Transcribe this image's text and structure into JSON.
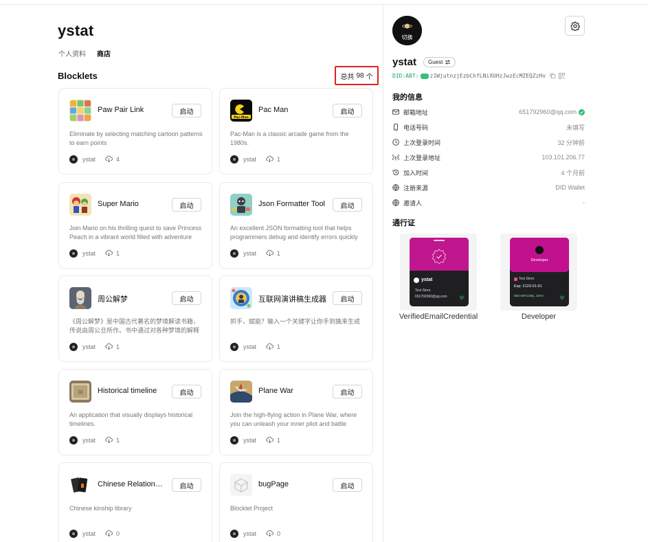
{
  "user": {
    "name": "ystat"
  },
  "nav": {
    "tabs": [
      "个人资料",
      "商店"
    ]
  },
  "blocklets": {
    "title": "Blocklets",
    "total_label": "总共",
    "total_count": "98",
    "total_unit": "个",
    "launch_label": "启动",
    "items": [
      {
        "name": "Paw Pair Link",
        "desc": "Eliminate by selecting matching cartoon patterns to earn points",
        "owner": "ystat",
        "installs": "4",
        "icon": "paw-pair-link-icon"
      },
      {
        "name": "Pac Man",
        "desc": "Pac-Man is a classic arcade game from the 1980s.",
        "owner": "ystat",
        "installs": "1",
        "icon": "pac-man-icon"
      },
      {
        "name": "Super Mario",
        "desc": "Join Mario on his thrilling quest to save Princess Peach in a vibrant world filled with adventure",
        "owner": "ystat",
        "installs": "1",
        "icon": "super-mario-icon"
      },
      {
        "name": "Json Formatter Tool",
        "desc": "An excellent JSON formatting tool that helps programmers debug and identify errors quickly",
        "owner": "ystat",
        "installs": "1",
        "icon": "json-formatter-icon"
      },
      {
        "name": "周公解梦",
        "desc": "《周公解梦》是中国古代著名的梦境解读书籍，传说由周公旦所作。书中通过对各种梦境的解释",
        "owner": "ystat",
        "installs": "1",
        "icon": "zhougong-icon"
      },
      {
        "name": "互联网演讲稿生成器",
        "desc": "抓手，赋能？输入一个关键字让你手到擒来生成",
        "owner": "ystat",
        "installs": "1",
        "icon": "speech-generator-icon"
      },
      {
        "name": "Historical timeline",
        "desc": "An application that visually displays historical timelines.",
        "owner": "ystat",
        "installs": "1",
        "icon": "historical-timeline-icon"
      },
      {
        "name": "Plane War",
        "desc": "Join the high-flying action in Plane War, where you can unleash your inner pilot and battle",
        "owner": "ystat",
        "installs": "1",
        "icon": "plane-war-icon"
      },
      {
        "name": "Chinese Relationship",
        "desc": "Chinese kinship library",
        "owner": "ystat",
        "installs": "0",
        "icon": "chinese-relationship-icon"
      },
      {
        "name": "bugPage",
        "desc": "Blocklet Project",
        "owner": "ystat",
        "installs": "0",
        "icon": "bugpage-icon"
      }
    ]
  },
  "profile": {
    "avatar_switch": "切换",
    "name": "ystat",
    "badge": "Guest",
    "did_prefix": "DID:ABT:",
    "did_value": "z1WjutnzjEzbChfLNiXUHzJwzEcMZEQZzHv",
    "info_title": "我的信息",
    "info": [
      {
        "label": "邮箱地址",
        "value": "651792960@qq.com",
        "icon": "mail-icon"
      },
      {
        "label": "电话号码",
        "value": "未填写",
        "icon": "phone-icon"
      },
      {
        "label": "上次登录时间",
        "value": "32 分钟前",
        "icon": "clock-icon"
      },
      {
        "label": "上次登录地址",
        "value": "103.101.206.77",
        "icon": "signal-icon"
      },
      {
        "label": "加入时间",
        "value": "4 个月前",
        "icon": "history-icon"
      },
      {
        "label": "注册来源",
        "value": "DID Wallet",
        "icon": "globe-icon"
      },
      {
        "label": "邀请人",
        "value": "-",
        "icon": "globe-user-icon"
      }
    ],
    "pass_title": "通行证",
    "passports": [
      {
        "label": "VerifiedEmailCredential",
        "holder": "ystat",
        "store": "Test Store",
        "email": "651792960@qq.com"
      },
      {
        "label": "Developer",
        "role": "Developer",
        "store": "Test Store",
        "exp": "Exp: 2123-01-01",
        "did_short": "DID:ABT:z1Wj...ZzHv"
      }
    ]
  },
  "colors": {
    "accent": "#c0168e",
    "highlight": "#e02020",
    "verified": "#2dbd6e"
  }
}
